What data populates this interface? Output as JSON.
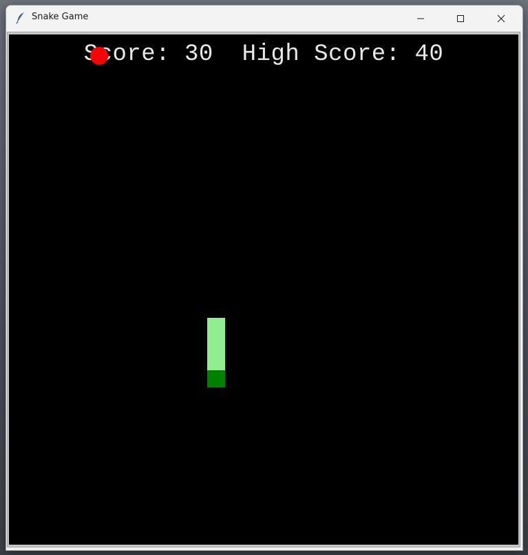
{
  "window": {
    "title": "Snake Game"
  },
  "scoreboard": {
    "score_label": "Score:",
    "score_value": "30",
    "high_score_label": "High Score:",
    "high_score_value": "40"
  },
  "game": {
    "background_color": "#000000",
    "food_color": "#ff0000",
    "snake_body_color": "#90ee90",
    "snake_head_color": "#008000",
    "snake_direction": "down"
  },
  "icons": {
    "app": "feather-icon",
    "minimize": "minimize-icon",
    "maximize": "maximize-icon",
    "close": "close-icon"
  }
}
